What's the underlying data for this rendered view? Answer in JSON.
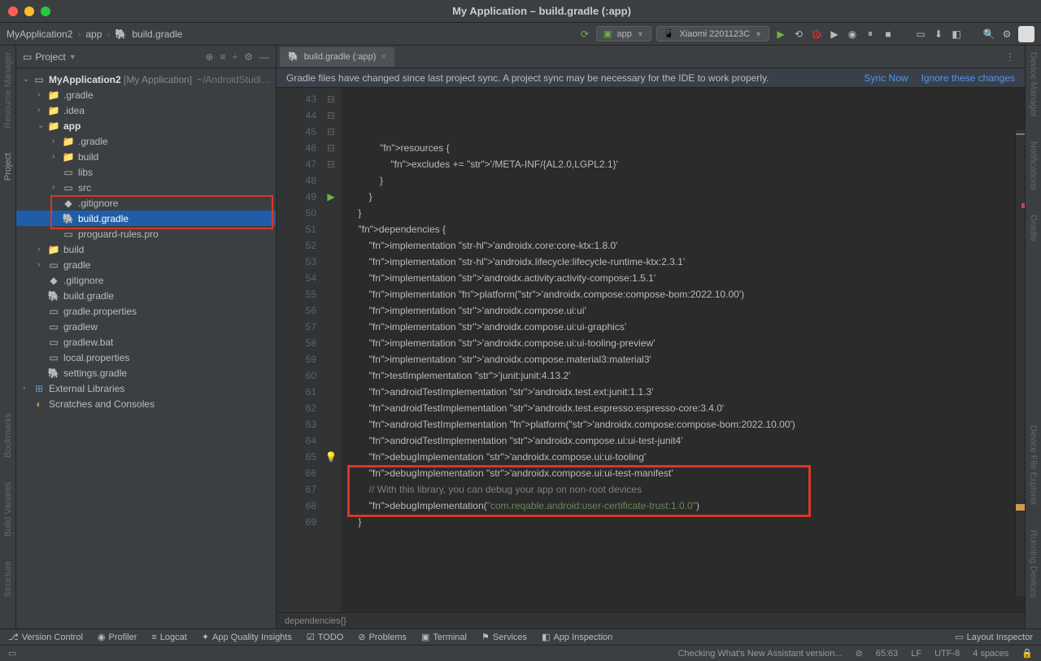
{
  "title": "My Application – build.gradle (:app)",
  "breadcrumb": {
    "root": "MyApplication2",
    "mid": "app",
    "file": "build.gradle"
  },
  "runConfig": {
    "app": "app",
    "device": "Xiaomi 2201123C"
  },
  "sidebar": {
    "viewLabel": "Project",
    "root": {
      "name": "MyApplication2",
      "badge": "[My Application]",
      "path": "~/AndroidStudi…"
    },
    "items": [
      {
        "name": ".gradle",
        "indent": 1,
        "arrow": "›",
        "icon": "📁"
      },
      {
        "name": ".idea",
        "indent": 1,
        "arrow": "›",
        "icon": "📁"
      },
      {
        "name": "app",
        "indent": 1,
        "arrow": "⌄",
        "icon": "📁",
        "bold": true
      },
      {
        "name": ".gradle",
        "indent": 2,
        "arrow": "›",
        "icon": "📁"
      },
      {
        "name": "build",
        "indent": 2,
        "arrow": "›",
        "icon": "📁"
      },
      {
        "name": "libs",
        "indent": 2,
        "arrow": "",
        "icon": "▭"
      },
      {
        "name": "src",
        "indent": 2,
        "arrow": "›",
        "icon": "▭"
      },
      {
        "name": ".gitignore",
        "indent": 2,
        "arrow": "",
        "icon": "◆"
      },
      {
        "name": "build.gradle",
        "indent": 2,
        "arrow": "",
        "icon": "🐘",
        "selected": true
      },
      {
        "name": "proguard-rules.pro",
        "indent": 2,
        "arrow": "",
        "icon": "▭"
      },
      {
        "name": "build",
        "indent": 1,
        "arrow": "›",
        "icon": "📁"
      },
      {
        "name": "gradle",
        "indent": 1,
        "arrow": "›",
        "icon": "▭"
      },
      {
        "name": ".gitignore",
        "indent": 1,
        "arrow": "",
        "icon": "◆"
      },
      {
        "name": "build.gradle",
        "indent": 1,
        "arrow": "",
        "icon": "🐘"
      },
      {
        "name": "gradle.properties",
        "indent": 1,
        "arrow": "",
        "icon": "▭"
      },
      {
        "name": "gradlew",
        "indent": 1,
        "arrow": "",
        "icon": "▭"
      },
      {
        "name": "gradlew.bat",
        "indent": 1,
        "arrow": "",
        "icon": "▭"
      },
      {
        "name": "local.properties",
        "indent": 1,
        "arrow": "",
        "icon": "▭"
      },
      {
        "name": "settings.gradle",
        "indent": 1,
        "arrow": "",
        "icon": "🐘"
      }
    ],
    "extLib": "External Libraries",
    "scratches": "Scratches and Consoles"
  },
  "leftRail": [
    "Resource Manager",
    "Project",
    "Bookmarks",
    "Build Variants",
    "Structure"
  ],
  "rightRail": [
    "Device Manager",
    "Notifications",
    "Gradle",
    "Device File Explorer",
    "Running Devices"
  ],
  "tab": {
    "label": "build.gradle (:app)"
  },
  "syncBanner": {
    "msg": "Gradle files have changed since last project sync. A project sync may be necessary for the IDE to work properly.",
    "syncNow": "Sync Now",
    "ignore": "Ignore these changes"
  },
  "code": {
    "startLine": 43,
    "lines": [
      {
        "n": 43,
        "t": "            resources {"
      },
      {
        "n": 44,
        "t": "                excludes += '/META-INF/{AL2.0,LGPL2.1}'"
      },
      {
        "n": 45,
        "t": "            }"
      },
      {
        "n": 46,
        "t": "        }"
      },
      {
        "n": 47,
        "t": "    }"
      },
      {
        "n": 48,
        "t": ""
      },
      {
        "n": 49,
        "t": "    dependencies {",
        "run": true
      },
      {
        "n": 50,
        "t": ""
      },
      {
        "n": 51,
        "t": "        implementation 'androidx.core:core-ktx:1.8.0'",
        "hl": true
      },
      {
        "n": 52,
        "t": "        implementation 'androidx.lifecycle:lifecycle-runtime-ktx:2.3.1'",
        "hl": true
      },
      {
        "n": 53,
        "t": "        implementation 'androidx.activity:activity-compose:1.5.1'"
      },
      {
        "n": 54,
        "t": "        implementation platform('androidx.compose:compose-bom:2022.10.00')"
      },
      {
        "n": 55,
        "t": "        implementation 'androidx.compose.ui:ui'"
      },
      {
        "n": 56,
        "t": "        implementation 'androidx.compose.ui:ui-graphics'"
      },
      {
        "n": 57,
        "t": "        implementation 'androidx.compose.ui:ui-tooling-preview'"
      },
      {
        "n": 58,
        "t": "        implementation 'androidx.compose.material3:material3'"
      },
      {
        "n": 59,
        "t": "        testImplementation 'junit:junit:4.13.2'"
      },
      {
        "n": 60,
        "t": "        androidTestImplementation 'androidx.test.ext:junit:1.1.3'"
      },
      {
        "n": 61,
        "t": "        androidTestImplementation 'androidx.test.espresso:espresso-core:3.4.0'"
      },
      {
        "n": 62,
        "t": "        androidTestImplementation platform('androidx.compose:compose-bom:2022.10.00')"
      },
      {
        "n": 63,
        "t": "        androidTestImplementation 'androidx.compose.ui:ui-test-junit4'"
      },
      {
        "n": 64,
        "t": "        debugImplementation 'androidx.compose.ui:ui-tooling'"
      },
      {
        "n": 65,
        "t": "        debugImplementation 'androidx.compose.ui:ui-test-manifest'",
        "bulb": true
      },
      {
        "n": 66,
        "t": ""
      },
      {
        "n": 67,
        "t": "        // With this library, you can debug your app on non-root devices",
        "comment": true
      },
      {
        "n": 68,
        "t": "        debugImplementation(\"com.reqable.android:user-certificate-trust:1.0.0\")"
      },
      {
        "n": 69,
        "t": "    }"
      }
    ],
    "crumb": "dependencies{}"
  },
  "bottombar": {
    "vcs": "Version Control",
    "profiler": "Profiler",
    "logcat": "Logcat",
    "quality": "App Quality Insights",
    "todo": "TODO",
    "problems": "Problems",
    "terminal": "Terminal",
    "services": "Services",
    "inspection": "App Inspection",
    "layout": "Layout Inspector"
  },
  "statusbar": {
    "msg": "Checking What's New Assistant version...",
    "pos": "65:63",
    "lf": "LF",
    "enc": "UTF-8",
    "indent": "4 spaces"
  }
}
